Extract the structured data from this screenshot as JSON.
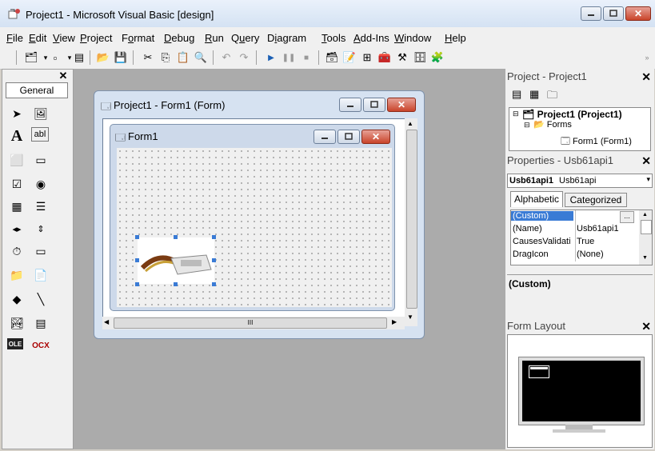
{
  "window": {
    "title": "Project1 - Microsoft Visual Basic [design]"
  },
  "menu": [
    {
      "label": "File",
      "u": "F",
      "rest": "ile"
    },
    {
      "label": "Edit",
      "u": "E",
      "rest": "dit"
    },
    {
      "label": "View",
      "u": "V",
      "rest": "iew"
    },
    {
      "label": "Project",
      "u": "P",
      "rest": "roject"
    },
    {
      "label": "Format",
      "pre": "F",
      "u": "o",
      "rest": "rmat"
    },
    {
      "label": "Debug",
      "u": "D",
      "rest": "ebug"
    },
    {
      "label": "Run",
      "u": "R",
      "rest": "un"
    },
    {
      "label": "Query",
      "pre": "Q",
      "u": "u",
      "rest": "ery"
    },
    {
      "label": "Diagram",
      "pre": "D",
      "u": "i",
      "rest": "agram"
    },
    {
      "label": "Tools",
      "u": "T",
      "rest": "ools"
    },
    {
      "label": "Add-Ins",
      "u": "A",
      "rest": "dd-Ins"
    },
    {
      "label": "Window",
      "u": "W",
      "rest": "indow"
    },
    {
      "label": "Help",
      "u": "H",
      "rest": "elp"
    }
  ],
  "toolbox": {
    "tab_label": "General",
    "close": "✕",
    "ole_label": "OLE",
    "ocx_label": "OCX",
    "text_tool": "abl"
  },
  "project_form": {
    "title": "Project1 - Form1 (Form)"
  },
  "form1": {
    "title": "Form1"
  },
  "hscroll_thumb": "III",
  "project_panel": {
    "title": "Project - Project1",
    "close": "✕",
    "tree": {
      "root": "Project1 (Project1)",
      "folder": "Forms",
      "leaf": "Form1 (Form1)"
    }
  },
  "properties_panel": {
    "title": "Properties - Usb61api1",
    "close": "✕",
    "object_name": "Usb61api1",
    "object_type": "Usb61api",
    "tabs": [
      "Alphabetic",
      "Categorized"
    ],
    "rows": [
      {
        "name": "(Custom)",
        "value": ""
      },
      {
        "name": "(Name)",
        "value": "Usb61api1"
      },
      {
        "name": "CausesValidati",
        "value": "True"
      },
      {
        "name": "DragIcon",
        "value": "(None)"
      }
    ],
    "ellipsis": "...",
    "description_title": "(Custom)"
  },
  "layout_panel": {
    "title": "Form Layout",
    "close": "✕"
  },
  "colors": {
    "selected_row": "#3a7bd5",
    "mdi_bg": "#ababab"
  }
}
